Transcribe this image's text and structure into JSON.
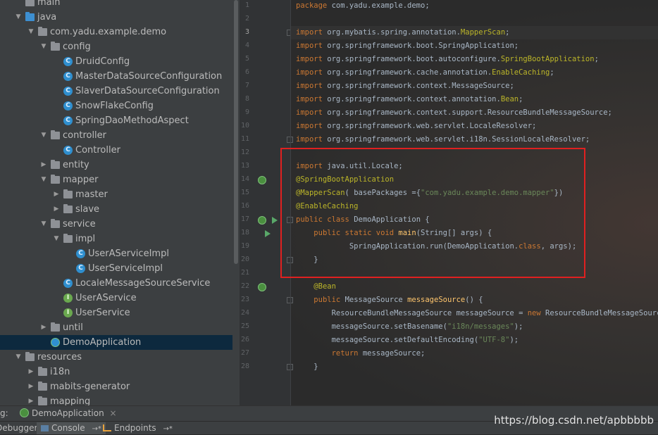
{
  "project_tree": {
    "rows": [
      {
        "label": "main",
        "icon": "folder-icon"
      },
      {
        "label": "java",
        "icon": "source-folder-icon"
      },
      {
        "label": "com.yadu.example.demo",
        "icon": "package-icon"
      },
      {
        "label": "config",
        "icon": "package-icon"
      },
      {
        "label": "DruidConfig",
        "icon": "class-icon"
      },
      {
        "label": "MasterDataSourceConfiguration",
        "icon": "class-icon"
      },
      {
        "label": "SlaverDataSourceConfiguration",
        "icon": "class-icon"
      },
      {
        "label": "SnowFlakeConfig",
        "icon": "class-icon"
      },
      {
        "label": "SpringDaoMethodAspect",
        "icon": "class-icon"
      },
      {
        "label": "controller",
        "icon": "package-icon"
      },
      {
        "label": "Controller",
        "icon": "class-icon"
      },
      {
        "label": "entity",
        "icon": "package-icon"
      },
      {
        "label": "mapper",
        "icon": "package-icon"
      },
      {
        "label": "master",
        "icon": "package-icon"
      },
      {
        "label": "slave",
        "icon": "package-icon"
      },
      {
        "label": "service",
        "icon": "package-icon"
      },
      {
        "label": "impl",
        "icon": "package-icon"
      },
      {
        "label": "UserAServiceImpl",
        "icon": "class-icon"
      },
      {
        "label": "UserServiceImpl",
        "icon": "class-icon"
      },
      {
        "label": "LocaleMessageSourceService",
        "icon": "class-icon"
      },
      {
        "label": "UserAService",
        "icon": "interface-icon"
      },
      {
        "label": "UserService",
        "icon": "interface-icon"
      },
      {
        "label": "until",
        "icon": "package-icon"
      },
      {
        "label": "DemoApplication",
        "icon": "spring-boot-app-icon"
      },
      {
        "label": "resources",
        "icon": "resources-folder-icon"
      },
      {
        "label": "i18n",
        "icon": "folder-icon"
      },
      {
        "label": "mabits-generator",
        "icon": "folder-icon"
      },
      {
        "label": "mapping",
        "icon": "folder-icon"
      }
    ],
    "class_glyph": "C",
    "interface_glyph": "I"
  },
  "editor": {
    "line_numbers": [
      "1",
      "2",
      "3",
      "4",
      "5",
      "6",
      "7",
      "8",
      "9",
      "10",
      "11",
      "12",
      "13",
      "14",
      "15",
      "16",
      "17",
      "18",
      "19",
      "20",
      "21",
      "22",
      "23",
      "24",
      "25",
      "26",
      "27",
      "28"
    ],
    "lines": [
      [
        [
          "kw",
          "package "
        ],
        [
          "",
          "com.yadu.example.demo;"
        ]
      ],
      [],
      [
        [
          "kw",
          "import "
        ],
        [
          "",
          "org.mybatis.spring.annotation."
        ],
        [
          "ann",
          "MapperScan"
        ],
        [
          "",
          ";"
        ]
      ],
      [
        [
          "kw",
          "import "
        ],
        [
          "",
          "org.springframework.boot.SpringApplication;"
        ]
      ],
      [
        [
          "kw",
          "import "
        ],
        [
          "",
          "org.springframework.boot.autoconfigure."
        ],
        [
          "ann",
          "SpringBootApplication"
        ],
        [
          "",
          ";"
        ]
      ],
      [
        [
          "kw",
          "import "
        ],
        [
          "",
          "org.springframework.cache.annotation."
        ],
        [
          "ann",
          "EnableCaching"
        ],
        [
          "",
          ";"
        ]
      ],
      [
        [
          "kw",
          "import "
        ],
        [
          "",
          "org.springframework.context.MessageSource;"
        ]
      ],
      [
        [
          "kw",
          "import "
        ],
        [
          "",
          "org.springframework.context.annotation."
        ],
        [
          "ann",
          "Bean"
        ],
        [
          "",
          ";"
        ]
      ],
      [
        [
          "kw",
          "import "
        ],
        [
          "",
          "org.springframework.context.support.ResourceBundleMessageSource;"
        ]
      ],
      [
        [
          "kw",
          "import "
        ],
        [
          "",
          "org.springframework.web.servlet.LocaleResolver;"
        ]
      ],
      [
        [
          "kw",
          "import "
        ],
        [
          "",
          "org.springframework.web.servlet.i18n.SessionLocaleResolver;"
        ]
      ],
      [],
      [
        [
          "kw",
          "import "
        ],
        [
          "",
          "java.util.Locale;"
        ]
      ],
      [
        [
          "ann",
          "@SpringBootApplication"
        ]
      ],
      [
        [
          "ann",
          "@MapperScan"
        ],
        [
          "",
          "( basePackages ={"
        ],
        [
          "str",
          "\"com.yadu.example.demo.mapper\""
        ],
        [
          "",
          "})"
        ]
      ],
      [
        [
          "ann",
          "@EnableCaching"
        ]
      ],
      [
        [
          "kw",
          "public class "
        ],
        [
          "",
          "DemoApplication {"
        ]
      ],
      [
        [
          "",
          "    "
        ],
        [
          "kw",
          "public static void "
        ],
        [
          "fn",
          "main"
        ],
        [
          "",
          "(String[] args) {"
        ]
      ],
      [
        [
          "",
          "            SpringApplication."
        ],
        [
          "",
          "run"
        ],
        [
          "",
          "(DemoApplication."
        ],
        [
          "kw",
          "class"
        ],
        [
          "",
          ", args);"
        ]
      ],
      [
        [
          "",
          "    }"
        ]
      ],
      [],
      [
        [
          "",
          "    "
        ],
        [
          "ann",
          "@Bean"
        ]
      ],
      [
        [
          "",
          "    "
        ],
        [
          "kw",
          "public "
        ],
        [
          "",
          "MessageSource "
        ],
        [
          "fn",
          "messageSource"
        ],
        [
          "",
          "() {"
        ]
      ],
      [
        [
          "",
          "        ResourceBundleMessageSource messageSource = "
        ],
        [
          "kw",
          "new "
        ],
        [
          "",
          "ResourceBundleMessageSource();"
        ]
      ],
      [
        [
          "",
          "        messageSource.setBasename("
        ],
        [
          "str",
          "\"i18n/messages\""
        ],
        [
          "",
          ");"
        ]
      ],
      [
        [
          "",
          "        messageSource.setDefaultEncoding("
        ],
        [
          "str",
          "\"UTF-8\""
        ],
        [
          "",
          ");"
        ]
      ],
      [
        [
          "",
          "        "
        ],
        [
          "kw",
          "return "
        ],
        [
          "",
          "messageSource;"
        ]
      ],
      [
        [
          "",
          "    }"
        ]
      ]
    ]
  },
  "run_bar": {
    "prefix": "g:",
    "tab_label": "DemoApplication",
    "close_glyph": "×"
  },
  "tool_bar": {
    "debugger_label": "Debugger",
    "console_label": "Console",
    "console_arrow": "→*",
    "endpoints_label": "Endpoints",
    "endpoints_arrow": "→*"
  },
  "watermark": "https://blog.csdn.net/apbbbbb"
}
